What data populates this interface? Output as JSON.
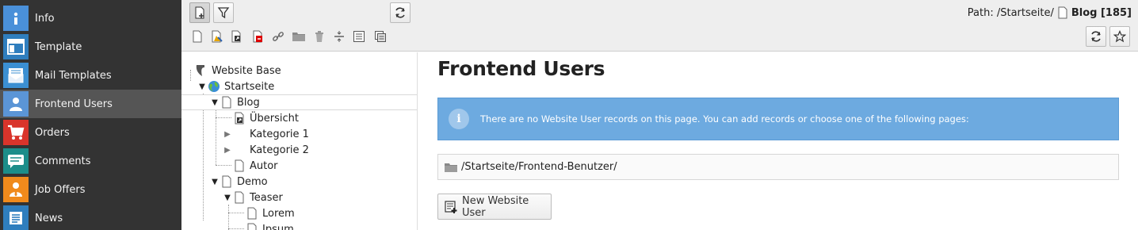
{
  "module_menu": {
    "items": [
      {
        "label": "Info",
        "icon": "info-icon",
        "color": "#4a90d9"
      },
      {
        "label": "Template",
        "icon": "template-icon",
        "color": "#2f7ebe"
      },
      {
        "label": "Mail Templates",
        "icon": "mail-template-icon",
        "color": "#3b8fd2"
      },
      {
        "label": "Frontend Users",
        "icon": "user-icon",
        "color": "#5b95d6",
        "active": true
      },
      {
        "label": "Orders",
        "icon": "cart-icon",
        "color": "#d9342b"
      },
      {
        "label": "Comments",
        "icon": "comments-icon",
        "color": "#1c8d8a"
      },
      {
        "label": "Job Offers",
        "icon": "job-offers-icon",
        "color": "#f08a1c"
      },
      {
        "label": "News",
        "icon": "news-icon",
        "color": "#2f7ebe"
      }
    ]
  },
  "docheader": {
    "path_prefix": "Path: /Startseite/",
    "page_name": "Blog [185]",
    "toolbar_icons": [
      "new-page-icon",
      "filter-icon",
      "refresh-icon"
    ],
    "tree_actions": [
      "page-icon",
      "new-page-wizard-icon",
      "page-link-icon",
      "page-delete-icon",
      "link-icon",
      "folder-icon",
      "trash-icon",
      "divider-icon",
      "list-icon",
      "list-view-icon"
    ],
    "right_buttons": [
      "refresh-icon",
      "bookmark-star-icon"
    ]
  },
  "tree": {
    "nodes": [
      {
        "label": "Website Base",
        "icon": "typo3-logo-icon",
        "level": 0,
        "toggle": ""
      },
      {
        "label": "Startseite",
        "icon": "globe-icon",
        "level": 1,
        "toggle": "▼"
      },
      {
        "label": "Blog",
        "icon": "page-icon",
        "level": 2,
        "toggle": "▼",
        "selected": true
      },
      {
        "label": "Übersicht",
        "icon": "shortcut-page-icon",
        "level": 3,
        "toggle": ""
      },
      {
        "label": "Kategorie 1",
        "icon": "",
        "level": 3,
        "toggle": "▶"
      },
      {
        "label": "Kategorie 2",
        "icon": "",
        "level": 3,
        "toggle": "▶"
      },
      {
        "label": "Autor",
        "icon": "page-icon",
        "level": 3,
        "toggle": ""
      },
      {
        "label": "Demo",
        "icon": "page-icon",
        "level": 2,
        "toggle": "▼"
      },
      {
        "label": "Teaser",
        "icon": "page-icon",
        "level": 3,
        "toggle": "▼"
      },
      {
        "label": "Lorem",
        "icon": "page-icon",
        "level": 4,
        "toggle": ""
      },
      {
        "label": "Ipsum",
        "icon": "page-icon",
        "level": 4,
        "toggle": ""
      }
    ]
  },
  "content": {
    "title": "Frontend Users",
    "info_text": "There are no Website User records on this page. You can add records or choose one of the following pages:",
    "page_link": "/Startseite/Frontend-Benutzer/",
    "new_button": "New Website User"
  },
  "colors": {
    "menu_bg": "#333333",
    "menu_active": "#555555",
    "info_bg": "#6daae0",
    "header_bg": "#eeeeee"
  }
}
